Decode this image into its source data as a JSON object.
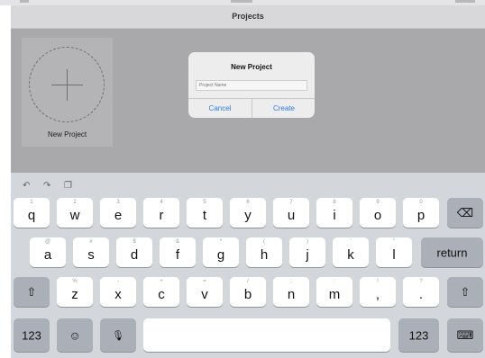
{
  "nav": {
    "title": "Projects"
  },
  "project_tile": {
    "label": "New Project"
  },
  "dialog": {
    "title": "New Project",
    "input_placeholder": "Project Name",
    "cancel_label": "Cancel",
    "create_label": "Create"
  },
  "shortcuts": {
    "undo_icon": "↶",
    "redo_icon": "↷",
    "paste_icon": "❐"
  },
  "keyboard": {
    "row1": [
      {
        "alt": "1",
        "main": "q"
      },
      {
        "alt": "2",
        "main": "w"
      },
      {
        "alt": "3",
        "main": "e"
      },
      {
        "alt": "4",
        "main": "r"
      },
      {
        "alt": "5",
        "main": "t"
      },
      {
        "alt": "6",
        "main": "y"
      },
      {
        "alt": "7",
        "main": "u"
      },
      {
        "alt": "8",
        "main": "i"
      },
      {
        "alt": "9",
        "main": "o"
      },
      {
        "alt": "0",
        "main": "p"
      }
    ],
    "delete_icon": "⌫",
    "row2": [
      {
        "alt": "@",
        "main": "a"
      },
      {
        "alt": "#",
        "main": "s"
      },
      {
        "alt": "$",
        "main": "d"
      },
      {
        "alt": "&",
        "main": "f"
      },
      {
        "alt": "*",
        "main": "g"
      },
      {
        "alt": "(",
        "main": "h"
      },
      {
        "alt": ")",
        "main": "j"
      },
      {
        "alt": "'",
        "main": "k"
      },
      {
        "alt": "\"",
        "main": "l"
      }
    ],
    "return_label": "return",
    "shift_icon": "⇧",
    "row3": [
      {
        "alt": "%",
        "main": "z"
      },
      {
        "alt": "-",
        "main": "x"
      },
      {
        "alt": "+",
        "main": "c"
      },
      {
        "alt": "=",
        "main": "v"
      },
      {
        "alt": "/",
        "main": "b"
      },
      {
        "alt": ";",
        "main": "n"
      },
      {
        "alt": ":",
        "main": "m"
      },
      {
        "alt": "!",
        "main": ","
      },
      {
        "alt": "?",
        "main": "."
      }
    ],
    "numbers_label": "123",
    "emoji_icon": "☺",
    "mic_icon": "🎙",
    "dismiss_icon": "⌨"
  }
}
